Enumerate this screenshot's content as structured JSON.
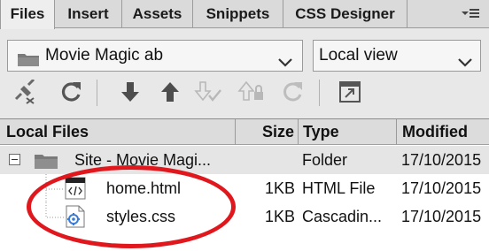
{
  "tabs": [
    {
      "label": "Files",
      "active": true
    },
    {
      "label": "Insert",
      "active": false
    },
    {
      "label": "Assets",
      "active": false
    },
    {
      "label": "Snippets",
      "active": false
    },
    {
      "label": "CSS Designer",
      "active": false
    }
  ],
  "site_select": {
    "value": "Movie Magic ab",
    "icon": "site-icon"
  },
  "view_select": {
    "value": "Local view"
  },
  "toolbar": {
    "buttons": [
      {
        "name": "connect-icon",
        "enabled": true
      },
      {
        "name": "refresh-icon",
        "enabled": true
      },
      {
        "name": "get-files-icon",
        "enabled": true
      },
      {
        "name": "put-files-icon",
        "enabled": true
      },
      {
        "name": "check-out-icon",
        "enabled": false
      },
      {
        "name": "check-in-icon",
        "enabled": false
      },
      {
        "name": "sync-icon",
        "enabled": false
      },
      {
        "name": "expand-icon",
        "enabled": true
      }
    ]
  },
  "table": {
    "columns": [
      "Local Files",
      "Size",
      "Type",
      "Modified"
    ],
    "rows": [
      {
        "name": "Site - Movie Magi...",
        "size": "",
        "type": "Folder",
        "modified": "17/10/2015",
        "icon": "folder-icon",
        "expanded": true
      },
      {
        "name": "home.html",
        "size": "1KB",
        "type": "HTML File",
        "modified": "17/10/2015",
        "icon": "html-file-icon"
      },
      {
        "name": "styles.css",
        "size": "1KB",
        "type": "Cascadin...",
        "modified": "17/10/2015",
        "icon": "css-file-icon"
      }
    ]
  },
  "colors": {
    "highlight_ring": "#e0181e",
    "panel_bg": "#e8e8e8",
    "header_bg": "#dcdcdc"
  }
}
